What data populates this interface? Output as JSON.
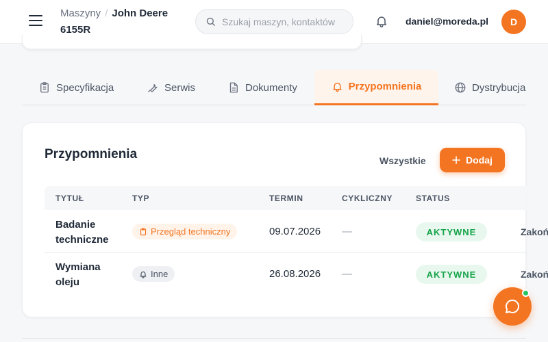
{
  "header": {
    "breadcrumb_parent": "Maszyny",
    "breadcrumb_separator": "/",
    "breadcrumb_current": "John Deere 6155R",
    "search_placeholder": "Szukaj maszyn, kontaktów",
    "notifications_icon": "bell-icon",
    "user_email": "daniel@moreda.pl",
    "avatar_initial": "D"
  },
  "tabs": [
    {
      "label": "Specyfikacja",
      "icon": "clipboard-icon",
      "active": false
    },
    {
      "label": "Serwis",
      "icon": "wrench-icon",
      "active": false
    },
    {
      "label": "Dokumenty",
      "icon": "document-icon",
      "active": false
    },
    {
      "label": "Przypomnienia",
      "icon": "bell-icon",
      "active": true
    },
    {
      "label": "Dystrybucja",
      "icon": "globe-icon",
      "active": false
    }
  ],
  "reminders": {
    "title": "Przypomnienia",
    "filter_label": "Wszystkie",
    "add_label": "Dodaj",
    "columns": [
      "TYTUŁ",
      "TYP",
      "TERMIN",
      "CYKLICZNY",
      "STATUS"
    ],
    "rows": [
      {
        "title": "Badanie techniczne",
        "type": "Przegląd techniczny",
        "type_icon": "clipboard-icon",
        "due": "09.07.2026",
        "cyclic": "—",
        "status": "AKTYWNE",
        "action": "Zakończ"
      },
      {
        "title": "Wymiana oleju",
        "type": "Inne",
        "type_icon": "bell-icon",
        "due": "26.08.2026",
        "cyclic": "—",
        "status": "AKTYWNE",
        "action": "Zakończ"
      }
    ]
  },
  "colors": {
    "accent": "#f47521",
    "status_active": "#16a34a",
    "online": "#22c55e"
  },
  "chat": {
    "icon": "chat-bubble-icon",
    "online": true
  }
}
